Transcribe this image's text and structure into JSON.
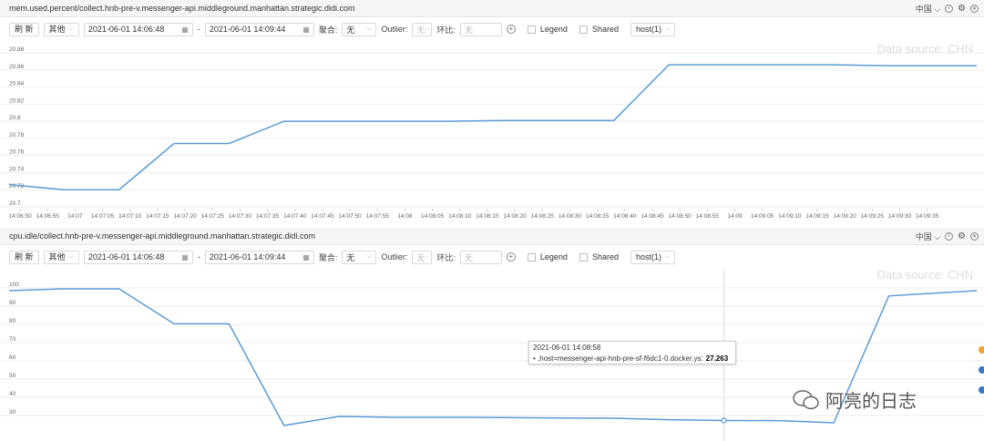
{
  "panels": [
    {
      "title": "mem.used.percent/collect.hnb-pre-v.messenger-api.middleground.manhattan.strategic.didi.com",
      "region": "中国",
      "toolbar": {
        "refresh": "刷 新",
        "range_select": "其他",
        "start_time": "2021-06-01 14:06:48",
        "sep": "-",
        "end_time": "2021-06-01 14:09:44",
        "agg_label": "聚合:",
        "agg_value": "无",
        "outlier_label": "Outlier:",
        "outlier_value": "无",
        "compare_label": "环比:",
        "compare_placeholder": "无",
        "legend_label": "Legend",
        "shared_label": "Shared",
        "host_select": "host(1)"
      },
      "watermark": "Data source: CHN"
    },
    {
      "title": "cpu.idle/collect.hnb-pre-v.messenger-api.middleground.manhattan.strategic.didi.com",
      "region": "中国",
      "toolbar": {
        "refresh": "刷 新",
        "range_select": "其他",
        "start_time": "2021-06-01 14:06:48",
        "sep": "-",
        "end_time": "2021-06-01 14:09:44",
        "agg_label": "聚合:",
        "agg_value": "无",
        "outlier_label": "Outlier:",
        "outlier_value": "无",
        "compare_label": "环比:",
        "compare_placeholder": "无",
        "legend_label": "Legend",
        "shared_label": "Shared",
        "host_select": "host(1)"
      },
      "watermark": "Data source: CHN"
    }
  ],
  "tooltip": {
    "time": "2021-06-01 14:08:58",
    "series": "• ,host=messenger-api-hnb-pre-sf-f6dc1-0.docker.ys:",
    "value": "27.263"
  },
  "brand_text": "阿亮的日志",
  "colors": {
    "line": "#5b9bd5",
    "grid": "#eeeeee",
    "accent_dots": [
      "#f0a030",
      "#3a78c8",
      "#3a78c8"
    ]
  },
  "chart_data": [
    {
      "type": "line",
      "title": "",
      "ylim": [
        20.7,
        20.88
      ],
      "yticks": [
        20.7,
        20.72,
        20.74,
        20.76,
        20.78,
        20.8,
        20.82,
        20.84,
        20.86,
        20.88
      ],
      "xticks": [
        "14:06:50",
        "14:06:55",
        "14:07",
        "14:07:05",
        "14:07:10",
        "14:07:15",
        "14:07:20",
        "14:07:25",
        "14:07:30",
        "14:07:35",
        "14:07:40",
        "14:07:45",
        "14:07:50",
        "14:07:55",
        "14:08",
        "14:08:05",
        "14:08:10",
        "14:08:15",
        "14:08:20",
        "14:08:25",
        "14:08:30",
        "14:08:35",
        "14:08:40",
        "14:08:45",
        "14:08:50",
        "14:08:55",
        "14:09",
        "14:09:05",
        "14:09:10",
        "14:09:15",
        "14:09:20",
        "14:09:25",
        "14:09:30",
        "14:09:35"
      ],
      "x": [
        "14:06:48",
        "14:06:58",
        "14:07:08",
        "14:07:18",
        "14:07:28",
        "14:07:38",
        "14:07:48",
        "14:07:58",
        "14:08:08",
        "14:08:18",
        "14:08:28",
        "14:08:38",
        "14:08:48",
        "14:08:58",
        "14:09:08",
        "14:09:18",
        "14:09:28",
        "14:09:44"
      ],
      "series": [
        {
          "values": [
            20.726,
            20.72,
            20.72,
            20.774,
            20.774,
            20.8,
            20.8,
            20.8,
            20.8,
            20.801,
            20.801,
            20.801,
            20.866,
            20.866,
            20.866,
            20.866,
            20.865,
            20.865
          ]
        }
      ]
    },
    {
      "type": "line",
      "title": "",
      "ylim": [
        20,
        105
      ],
      "yticks": [
        30,
        40,
        50,
        60,
        70,
        80,
        90,
        100
      ],
      "x": [
        "14:06:48",
        "14:06:58",
        "14:07:08",
        "14:07:18",
        "14:07:28",
        "14:07:38",
        "14:07:48",
        "14:07:58",
        "14:08:08",
        "14:08:18",
        "14:08:28",
        "14:08:38",
        "14:08:48",
        "14:08:58",
        "14:09:08",
        "14:09:18",
        "14:09:28",
        "14:09:44"
      ],
      "series": [
        {
          "values": [
            98.5,
            99.5,
            99.5,
            80.3,
            80.3,
            24.5,
            29.5,
            29,
            29,
            28.9,
            28.6,
            28.5,
            27.7,
            27.263,
            27.2,
            26,
            95.6,
            98.5
          ]
        }
      ]
    }
  ]
}
